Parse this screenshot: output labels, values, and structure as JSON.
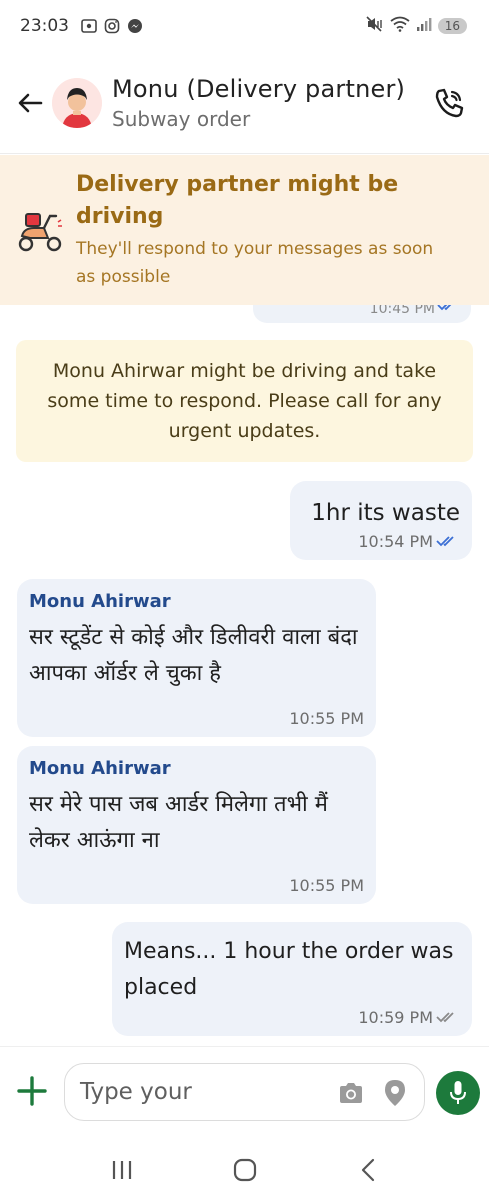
{
  "status_bar": {
    "time": "23:03",
    "battery": "16",
    "left_icons": [
      "screen-record-icon",
      "instagram-icon",
      "messenger-icon"
    ],
    "right_icons": [
      "mute-vibrate-icon",
      "wifi-icon",
      "signal-icon",
      "battery-icon"
    ]
  },
  "header": {
    "title": "Monu (Delivery partner)",
    "subtitle": "Subway order",
    "icons": [
      "back-arrow-icon",
      "delivery-partner-avatar",
      "phone-call-icon"
    ]
  },
  "banner": {
    "title": "Delivery partner might be driving",
    "subtitle": "They'll respond to your messages as soon as possible",
    "icon": "scooter-icon",
    "colors": {
      "background": "#fcf1e2",
      "title": "#9a6a15"
    }
  },
  "chat": {
    "previous_message_time": "10:45 PM",
    "info_card": "Monu Ahirwar might be driving and take some time to respond. Please call for any urgent updates.",
    "messages": [
      {
        "direction": "outgoing",
        "text": "1hr its waste",
        "time": "10:54 PM",
        "ticks": "read"
      },
      {
        "direction": "incoming",
        "sender": "Monu Ahirwar",
        "text": "सर स्टूडेंट से कोई और डिलीवरी वाला बंदा आपका ऑर्डर ले चुका है",
        "time": "10:55 PM"
      },
      {
        "direction": "incoming",
        "sender": "Monu Ahirwar",
        "text": "सर मेरे पास जब आर्डर मिलेगा तभी मैं लेकर आऊंगा ना",
        "time": "10:55 PM"
      },
      {
        "direction": "outgoing",
        "text": "Means... 1 hour the order was placed",
        "time": "10:59 PM",
        "ticks": "delivered"
      }
    ],
    "colors": {
      "bubble": "#eef2f9",
      "sender": "#234a8c",
      "read_tick": "#3b6fd4",
      "delivered_tick": "#8a8a8a"
    }
  },
  "input": {
    "placeholder": "Type your",
    "icons": [
      "plus-icon",
      "camera-icon",
      "location-pin-icon",
      "microphone-icon"
    ],
    "colors": {
      "accent": "#1d7a3c"
    }
  },
  "nav": {
    "icons": [
      "recent-apps-icon",
      "home-icon",
      "back-icon"
    ]
  }
}
